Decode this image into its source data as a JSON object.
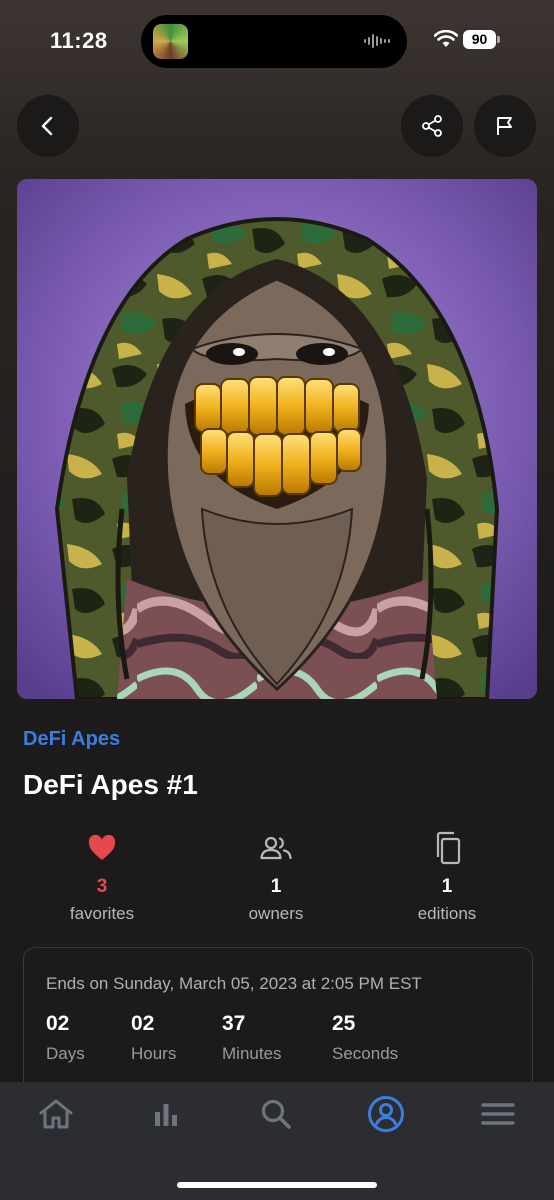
{
  "status_bar": {
    "time": "11:28",
    "battery": "90"
  },
  "nav": {
    "back_icon": "chevron-left-icon",
    "share_icon": "share-icon",
    "report_icon": "flag-icon"
  },
  "nft": {
    "collection": "DeFi Apes",
    "title": "DeFi Apes #1",
    "image": "hooded-ape-gold-grill-artwork"
  },
  "stats": {
    "favorites": {
      "count": "3",
      "label": "favorites",
      "icon": "heart-icon",
      "color": "#e5484d"
    },
    "owners": {
      "count": "1",
      "label": "owners",
      "icon": "people-icon"
    },
    "editions": {
      "count": "1",
      "label": "editions",
      "icon": "copy-icon"
    }
  },
  "auction": {
    "ends_text": "Ends on Sunday, March 05, 2023 at 2:05 PM EST",
    "days": "02",
    "days_label": "Days",
    "hours": "02",
    "hours_label": "Hours",
    "minutes": "37",
    "minutes_label": "Minutes",
    "seconds": "25",
    "seconds_label": "Seconds"
  },
  "tab_bar": {
    "tabs": [
      "home-icon",
      "stats-icon",
      "search-icon",
      "profile-icon",
      "menu-icon"
    ],
    "active": "profile-icon",
    "accent": "#3a7fe0"
  }
}
